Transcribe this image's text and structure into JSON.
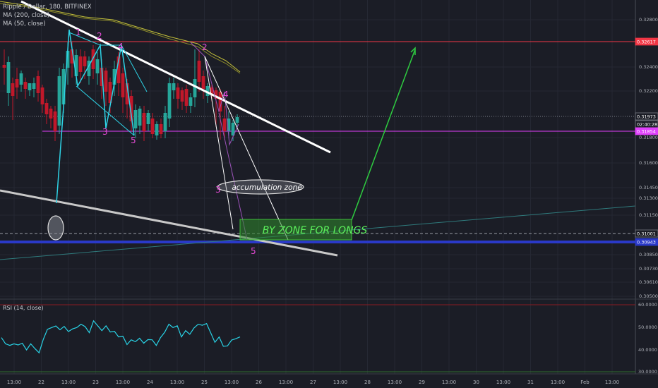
{
  "header": {
    "symbol_line": "Ripple / Dollar, 180, BITFINEX",
    "ma200_label": "MA (200, close)",
    "ma50_label": "MA (50, close)"
  },
  "rsi": {
    "label": "RSI (14, close)",
    "axis_ticks": [
      "60.0000",
      "50.0000",
      "40.0000",
      "30.0000"
    ]
  },
  "price_axis": {
    "ticks": [
      "0.32800",
      "0.32400",
      "0.32200",
      "0.31800",
      "0.31600",
      "0.31450",
      "0.31300",
      "0.31150",
      "0.30850",
      "0.30730",
      "0.30610",
      "0.30500"
    ],
    "badges": [
      {
        "text": "0.32617",
        "color": "#f23645"
      },
      {
        "text": "0.31973",
        "color": "#1b1d26"
      },
      {
        "text": "02:40:28",
        "color": "#1b1d26"
      },
      {
        "text": "0.31854",
        "color": "#e040fb"
      },
      {
        "text": "0.31001",
        "color": "#1b1d26"
      },
      {
        "text": "0.30943",
        "color": "#2a39c8"
      }
    ]
  },
  "time_axis": {
    "labels": [
      "13:00",
      "22",
      "13:00",
      "23",
      "13:00",
      "24",
      "13:00",
      "25",
      "13:00",
      "26",
      "13:00",
      "27",
      "13:00",
      "28",
      "13:00",
      "29",
      "13:00",
      "30",
      "13:00",
      "31",
      "13:00",
      "Feb",
      "13:00"
    ]
  },
  "annotations": {
    "accumulation_zone": "accumulation zone",
    "buy_zone": "BY ZONE FOR LONGS",
    "wave_labels": [
      "1",
      "2",
      "3",
      "4",
      "5",
      "2",
      "3",
      "4",
      "5"
    ]
  },
  "colors": {
    "background": "#1b1d26",
    "candle_up": "#26a69a",
    "candle_down": "#c0182a",
    "ma200": "#c5c23a",
    "ma50": "#c5c23a",
    "rsi_line": "#29d3e6",
    "resistance": "#f23645",
    "support_blue": "#2a39c8",
    "pink_level": "#e040fb",
    "green_projection": "#2ecc40",
    "wave_pink": "#e54bd6",
    "wave_cyan": "#2ed3e6"
  },
  "chart_data": {
    "type": "candlestick",
    "symbol": "Ripple / Dollar",
    "timeframe": "180",
    "exchange": "BITFINEX",
    "levels": {
      "resistance": 0.32617,
      "last_price": 0.31973,
      "pink_level": 0.31854,
      "dashed_level": 0.31001,
      "blue_support": 0.30943
    },
    "rsi_range": [
      30,
      60
    ],
    "rsi_values": [
      45.3,
      42.5,
      41.8,
      42.5,
      42.0,
      42.8,
      39.8,
      42.5,
      40.4,
      38.5,
      44.5,
      49.0,
      49.8,
      50.5,
      48.8,
      50.3,
      48.0,
      49.2,
      49.8,
      51.3,
      50.2,
      47.5,
      52.8,
      50.6,
      48.4,
      50.6,
      47.8,
      48.1,
      45.6,
      45.9,
      42.2,
      44.3,
      43.5,
      45.0,
      42.8,
      44.4,
      44.3,
      41.8,
      45.3,
      47.7,
      51.3,
      49.8,
      50.6,
      45.6,
      48.4,
      46.8,
      49.6,
      51.3,
      50.8,
      51.6,
      47.4,
      43.2,
      45.6,
      41.4,
      41.6,
      44.2,
      44.8,
      45.6
    ]
  }
}
